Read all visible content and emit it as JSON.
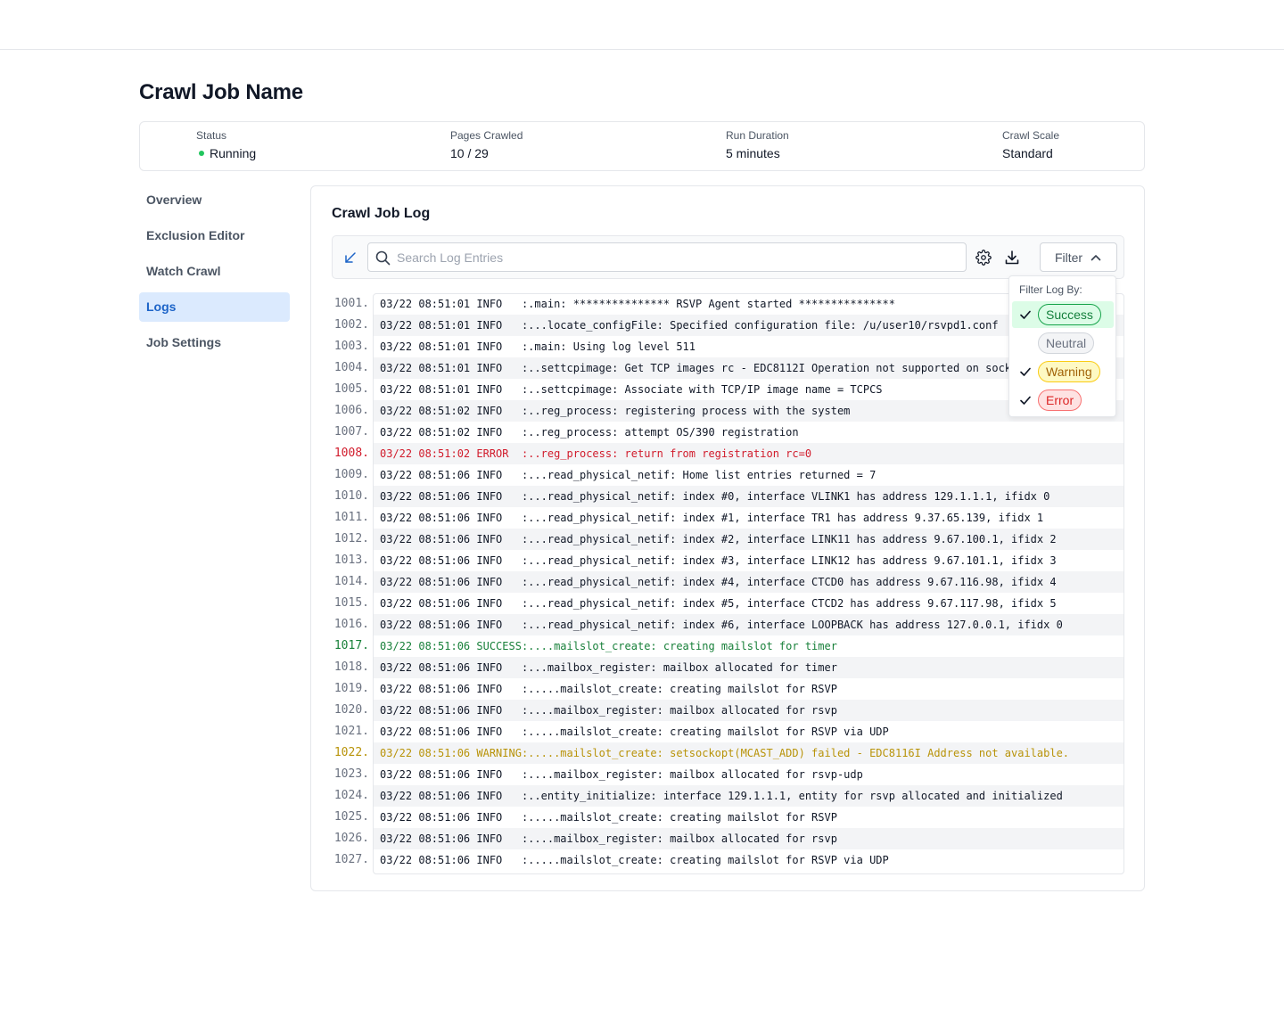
{
  "page": {
    "title": "Crawl Job Name"
  },
  "stats": [
    {
      "label": "Status",
      "value": "Running",
      "status_color": "#22c55e"
    },
    {
      "label": "Pages Crawled",
      "value": "10 / 29"
    },
    {
      "label": "Run Duration",
      "value": "5 minutes"
    },
    {
      "label": "Crawl Scale",
      "value": "Standard"
    }
  ],
  "nav": {
    "items": [
      {
        "label": "Overview",
        "active": false
      },
      {
        "label": "Exclusion Editor",
        "active": false
      },
      {
        "label": "Watch Crawl",
        "active": false
      },
      {
        "label": "Logs",
        "active": true
      },
      {
        "label": "Job Settings",
        "active": false
      }
    ]
  },
  "log_panel": {
    "title": "Crawl Job Log",
    "search_placeholder": "Search Log Entries",
    "search_value": "",
    "filter_label": "Filter"
  },
  "filter_menu": {
    "title": "Filter Log By:",
    "options": [
      {
        "label": "Success",
        "checked": true,
        "style": "success"
      },
      {
        "label": "Neutral",
        "checked": false,
        "style": "neutral"
      },
      {
        "label": "Warning",
        "checked": true,
        "style": "warning"
      },
      {
        "label": "Error",
        "checked": true,
        "style": "error"
      }
    ]
  },
  "colors": {
    "accent": "#1d64c8",
    "error": "#d11c2c",
    "success": "#18803a",
    "warning": "#b89309"
  },
  "log_entries": [
    {
      "line": "1001.",
      "level": "info",
      "text": "03/22 08:51:01 INFO   :.main: *************** RSVP Agent started ***************"
    },
    {
      "line": "1002.",
      "level": "info",
      "text": "03/22 08:51:01 INFO   :...locate_configFile: Specified configuration file: /u/user10/rsvpd1.conf"
    },
    {
      "line": "1003.",
      "level": "info",
      "text": "03/22 08:51:01 INFO   :.main: Using log level 511"
    },
    {
      "line": "1004.",
      "level": "info",
      "text": "03/22 08:51:01 INFO   :..settcpimage: Get TCP images rc - EDC8112I Operation not supported on sock"
    },
    {
      "line": "1005.",
      "level": "info",
      "text": "03/22 08:51:01 INFO   :..settcpimage: Associate with TCP/IP image name = TCPCS"
    },
    {
      "line": "1006.",
      "level": "info",
      "text": "03/22 08:51:02 INFO   :..reg_process: registering process with the system"
    },
    {
      "line": "1007.",
      "level": "info",
      "text": "03/22 08:51:02 INFO   :..reg_process: attempt OS/390 registration"
    },
    {
      "line": "1008.",
      "level": "error",
      "text": "03/22 08:51:02 ERROR  :..reg_process: return from registration rc=0"
    },
    {
      "line": "1009.",
      "level": "info",
      "text": "03/22 08:51:06 INFO   :...read_physical_netif: Home list entries returned = 7"
    },
    {
      "line": "1010.",
      "level": "info",
      "text": "03/22 08:51:06 INFO   :...read_physical_netif: index #0, interface VLINK1 has address 129.1.1.1, ifidx 0"
    },
    {
      "line": "1011.",
      "level": "info",
      "text": "03/22 08:51:06 INFO   :...read_physical_netif: index #1, interface TR1 has address 9.37.65.139, ifidx 1"
    },
    {
      "line": "1012.",
      "level": "info",
      "text": "03/22 08:51:06 INFO   :...read_physical_netif: index #2, interface LINK11 has address 9.67.100.1, ifidx 2"
    },
    {
      "line": "1013.",
      "level": "info",
      "text": "03/22 08:51:06 INFO   :...read_physical_netif: index #3, interface LINK12 has address 9.67.101.1, ifidx 3"
    },
    {
      "line": "1014.",
      "level": "info",
      "text": "03/22 08:51:06 INFO   :...read_physical_netif: index #4, interface CTCD0 has address 9.67.116.98, ifidx 4"
    },
    {
      "line": "1015.",
      "level": "info",
      "text": "03/22 08:51:06 INFO   :...read_physical_netif: index #5, interface CTCD2 has address 9.67.117.98, ifidx 5"
    },
    {
      "line": "1016.",
      "level": "info",
      "text": "03/22 08:51:06 INFO   :...read_physical_netif: index #6, interface LOOPBACK has address 127.0.0.1, ifidx 0"
    },
    {
      "line": "1017.",
      "level": "success",
      "text": "03/22 08:51:06 SUCCESS:....mailslot_create: creating mailslot for timer"
    },
    {
      "line": "1018.",
      "level": "info",
      "text": "03/22 08:51:06 INFO   :...mailbox_register: mailbox allocated for timer"
    },
    {
      "line": "1019.",
      "level": "info",
      "text": "03/22 08:51:06 INFO   :.....mailslot_create: creating mailslot for RSVP"
    },
    {
      "line": "1020.",
      "level": "info",
      "text": "03/22 08:51:06 INFO   :....mailbox_register: mailbox allocated for rsvp"
    },
    {
      "line": "1021.",
      "level": "info",
      "text": "03/22 08:51:06 INFO   :.....mailslot_create: creating mailslot for RSVP via UDP"
    },
    {
      "line": "1022.",
      "level": "warning",
      "text": "03/22 08:51:06 WARNING:.....mailslot_create: setsockopt(MCAST_ADD) failed - EDC8116I Address not available."
    },
    {
      "line": "1023.",
      "level": "info",
      "text": "03/22 08:51:06 INFO   :....mailbox_register: mailbox allocated for rsvp-udp"
    },
    {
      "line": "1024.",
      "level": "info",
      "text": "03/22 08:51:06 INFO   :..entity_initialize: interface 129.1.1.1, entity for rsvp allocated and initialized"
    },
    {
      "line": "1025.",
      "level": "info",
      "text": "03/22 08:51:06 INFO   :.....mailslot_create: creating mailslot for RSVP"
    },
    {
      "line": "1026.",
      "level": "info",
      "text": "03/22 08:51:06 INFO   :....mailbox_register: mailbox allocated for rsvp"
    },
    {
      "line": "1027.",
      "level": "info",
      "text": "03/22 08:51:06 INFO   :.....mailslot_create: creating mailslot for RSVP via UDP"
    }
  ]
}
